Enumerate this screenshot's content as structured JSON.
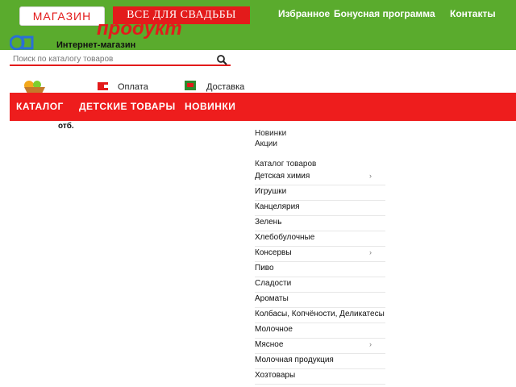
{
  "header": {
    "tab_shop": "МАГАЗИН",
    "tab_wedding": "ВСЕ ДЛЯ СВАДЬБЫ",
    "logo_main": "продукт",
    "logo_subtitle": "Интернет-магазин",
    "links": [
      "Избранное",
      "Бонусная программа",
      "Контакты"
    ]
  },
  "search": {
    "placeholder": "Поиск по каталогу товаров"
  },
  "quick": {
    "items": [
      "Оплата",
      "Доставка"
    ]
  },
  "nav": {
    "items": [
      "КАТАЛОГ",
      "ДЕТСКИЕ ТОВАРЫ",
      "НОВИНКИ"
    ]
  },
  "main": {
    "small_text": "отб."
  },
  "menu": {
    "headings": [
      "Новинки",
      "Акции",
      "Каталог товаров"
    ],
    "items": [
      "Детская химия",
      "Игрушки",
      "Канцелярия",
      "Зелень",
      "Хлебобулочные",
      "Консервы",
      "Пиво",
      "Сладости",
      "Ароматы",
      "Колбасы, Копчёности, Деликатесы",
      "Молочное",
      "Мясное",
      "Молочная продукция",
      "Хозтовары"
    ]
  },
  "colors": {
    "green": "#5aab2d",
    "red": "#ee1d1d"
  }
}
